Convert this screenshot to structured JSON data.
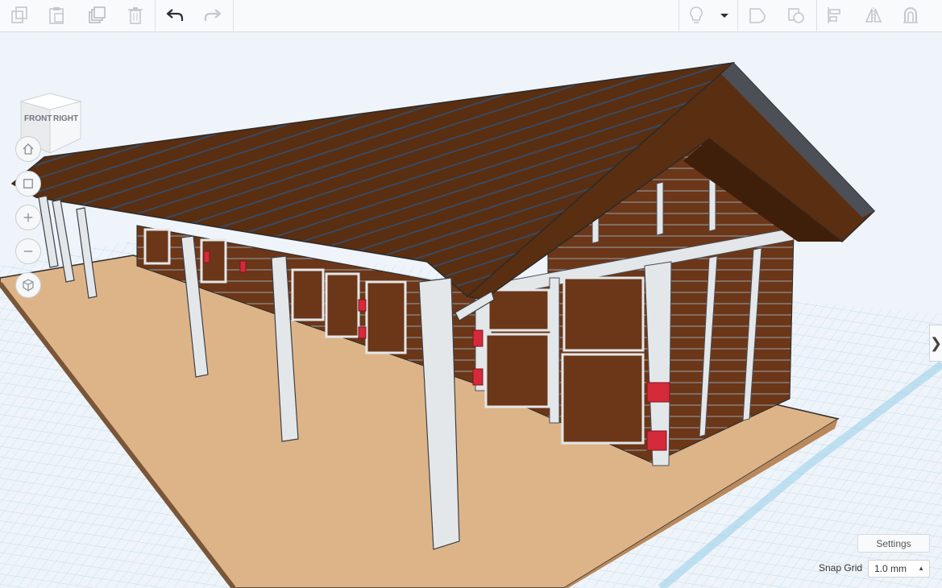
{
  "viewcube": {
    "front_label": "FRONT",
    "right_label": "RIGHT"
  },
  "toolbar": {
    "icons": [
      "copy-icon",
      "paste-icon",
      "duplicate-icon",
      "delete-icon",
      "undo-icon",
      "redo-icon",
      "lightbulb-icon",
      "dropdown-caret-icon",
      "shape-icon",
      "hole-icon",
      "align-icon",
      "mirror-icon",
      "group-icon"
    ]
  },
  "bottom": {
    "settings_label": "Settings",
    "snap_grid_label": "Snap Grid",
    "snap_grid_value": "1.0 mm"
  },
  "colors": {
    "roof": "#5a2e10",
    "wall_wood": "#6b3718",
    "trim": "#e4e7ea",
    "floor": "#ddb488",
    "grid": "#bcd9ea",
    "accent_red": "#d42a3a"
  }
}
